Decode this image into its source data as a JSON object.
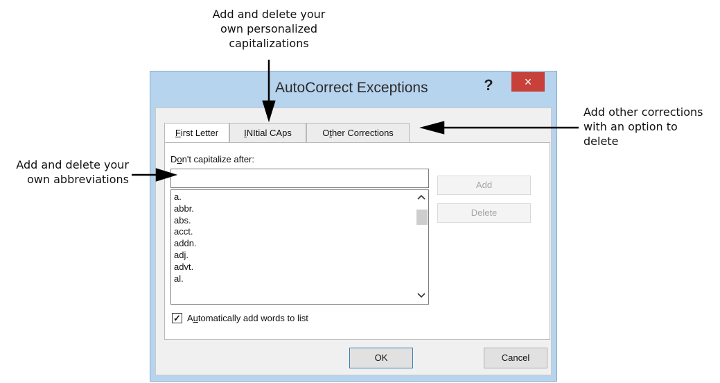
{
  "callouts": {
    "top": [
      "Add and delete your",
      "own personalized",
      "capitalizations"
    ],
    "right": [
      "Add other corrections",
      "with an option to",
      "delete"
    ],
    "left": [
      "Add and delete your",
      "own abbreviations"
    ]
  },
  "dialog": {
    "title": "AutoCorrect Exceptions",
    "help_label": "?",
    "close_label": "×",
    "tabs": [
      {
        "pre": "",
        "key": "F",
        "post": "irst Letter",
        "active": true
      },
      {
        "pre": "",
        "key": "I",
        "post": "NItial CAps",
        "active": false
      },
      {
        "pre": "O",
        "key": "t",
        "post": "her Corrections",
        "active": false
      }
    ],
    "dont_capitalize": {
      "pre": "D",
      "key": "o",
      "post": "n't capitalize after:"
    },
    "entry_value": "",
    "list_items": [
      "a.",
      "abbr.",
      "abs.",
      "acct.",
      "addn.",
      "adj.",
      "advt.",
      "al."
    ],
    "scroll_up": "^",
    "scroll_down": "v",
    "add_label": "Add",
    "delete_label": "Delete",
    "auto_add": {
      "pre": "A",
      "key": "u",
      "post": "tomatically add words to list",
      "checked": true,
      "check_glyph": "✓"
    },
    "ok_label": "OK",
    "cancel_label": "Cancel"
  },
  "colors": {
    "frame": "#b7d4ee",
    "close_button": "#c7403a"
  }
}
